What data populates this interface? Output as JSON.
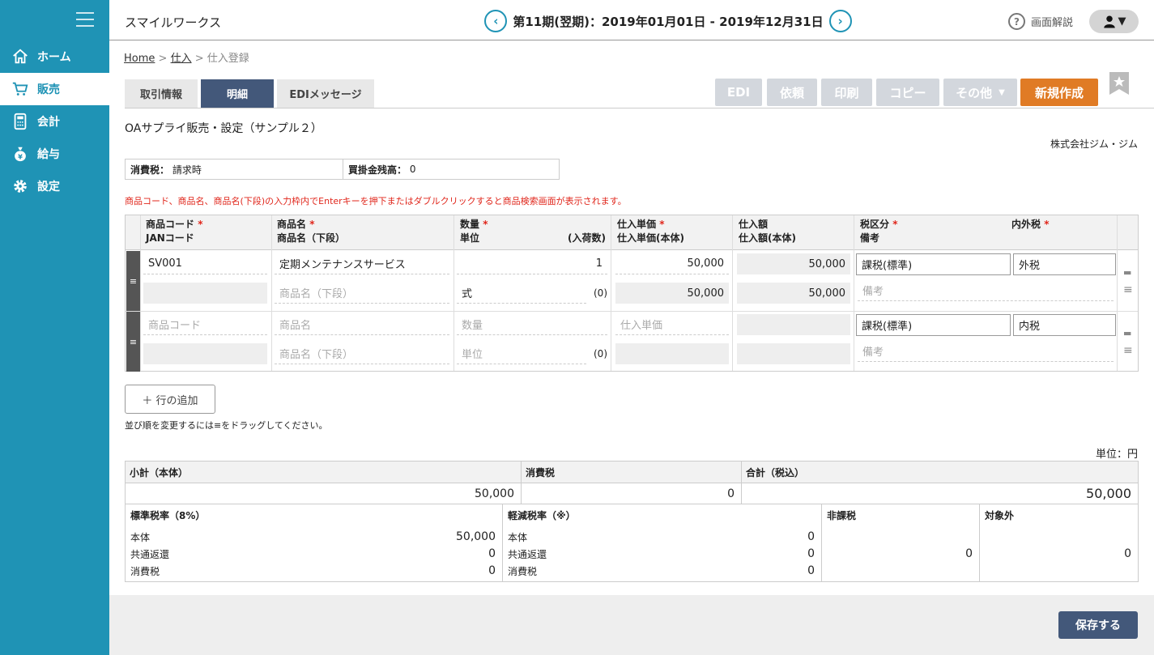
{
  "sidebar": {
    "items": [
      {
        "label": "ホーム",
        "icon": "home-icon"
      },
      {
        "label": "販売",
        "icon": "cart-icon"
      },
      {
        "label": "会計",
        "icon": "calculator-icon"
      },
      {
        "label": "給与",
        "icon": "money-bag-icon"
      },
      {
        "label": "設定",
        "icon": "gear-icon"
      }
    ],
    "active": "販売"
  },
  "header": {
    "company": "スマイルワークス",
    "period": "第11期(翌期)：2019年01月01日 - 2019年12月31日",
    "help": "画面解説",
    "prev_arrow": "‹",
    "next_arrow": "›",
    "user_arrow": "▼"
  },
  "breadcrumb": {
    "home": "Home",
    "sep": ">",
    "purchase": "仕入",
    "current": "仕入登録"
  },
  "tabs": [
    "取引情報",
    "明細",
    "EDIメッセージ"
  ],
  "toolbar": {
    "edi": "EDI",
    "request": "依頼",
    "print": "印刷",
    "copy": "コピー",
    "other": "その他",
    "other_arrow": "▼",
    "new": "新規作成"
  },
  "doc": {
    "title": "OAサプライ販売・設定（サンプル２）",
    "partner": "株式会社ジム・ジム"
  },
  "tax_info": {
    "tax_label": "消費税：",
    "tax_value": "請求時",
    "payable_label": "買掛金残高：",
    "payable_value": "0"
  },
  "notice": "商品コード、商品名、商品名(下段)の入力枠内でEnterキーを押下またはダブルクリックすると商品検索画面が表示されます。",
  "grid": {
    "headers": {
      "code": "商品コード",
      "jan": "JANコード",
      "name": "商品名",
      "name2": "商品名（下段）",
      "qty": "数量",
      "unit": "単位",
      "arrival": "(入荷数)",
      "price": "仕入単価",
      "price_body": "仕入単価(本体)",
      "amount": "仕入額",
      "amount_body": "仕入額(本体)",
      "taxcat": "税区分",
      "memo": "備考",
      "inout": "内外税",
      "req": "*"
    },
    "rows": [
      {
        "handle": "≡",
        "code": "SV001",
        "jan": "",
        "name": "定期メンテナンスサービス",
        "name2": "",
        "qty": "1",
        "unit": "式",
        "arrival": "(0)",
        "price": "50,000",
        "price_body": "50,000",
        "amount": "50,000",
        "amount_body": "50,000",
        "taxcat": "課税(標準)",
        "inout": "外税",
        "memo": ""
      },
      {
        "handle": "≡",
        "code": "",
        "jan": "",
        "name": "",
        "name2": "",
        "qty": "",
        "unit": "",
        "arrival": "(0)",
        "price": "",
        "price_body": "",
        "amount": "",
        "amount_body": "",
        "taxcat": "課税(標準)",
        "inout": "内税",
        "memo": ""
      }
    ],
    "placeholders": {
      "code": "商品コード",
      "name": "商品名",
      "name2": "商品名（下段）",
      "qty": "数量",
      "unit": "単位",
      "price": "仕入単価",
      "memo": "備考"
    },
    "side_comment": "▬",
    "side_menu": "≡"
  },
  "add_row": "＋ 行の追加",
  "drag_hint": "並び順を変更するには≡をドラッグしてください。",
  "unit_label": "単位：円",
  "totals": {
    "subtotal_label": "小計（本体）",
    "tax_label": "消費税",
    "total_label": "合計（税込）",
    "subtotal": "50,000",
    "tax": "0",
    "total": "50,000"
  },
  "breakdown": {
    "standard": {
      "title": "標準税率（8%）",
      "body_label": "本体",
      "body": "50,000",
      "rebate_label": "共通返還",
      "rebate": "0",
      "tax_label": "消費税",
      "tax": "0"
    },
    "reduced": {
      "title": "軽減税率（※）",
      "body_label": "本体",
      "body": "0",
      "rebate_label": "共通返還",
      "rebate": "0",
      "tax_label": "消費税",
      "tax": "0"
    },
    "nontax": {
      "title": "非課税",
      "value": "0"
    },
    "excluded": {
      "title": "対象外",
      "value": "0"
    }
  },
  "footer": {
    "save": "保存する"
  },
  "colors": {
    "sidebar": "#1f93b5",
    "tab_active": "#43587a",
    "new_button": "#e07b25",
    "required": "#e0261b"
  }
}
